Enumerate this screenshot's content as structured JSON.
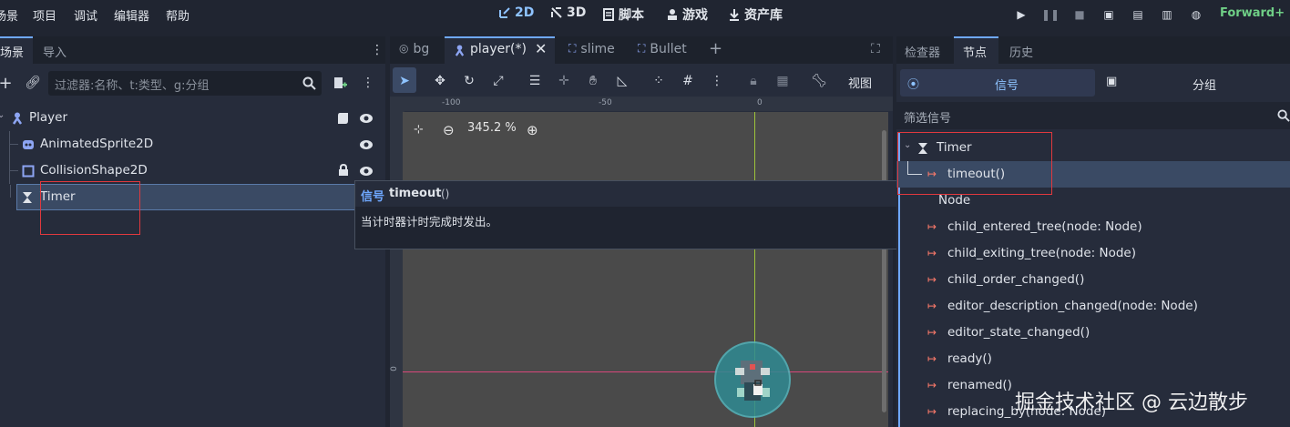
{
  "menu": [
    "场景",
    "项目",
    "调试",
    "编辑器",
    "帮助"
  ],
  "workspaces": [
    {
      "label": "2D",
      "active": true
    },
    {
      "label": "3D",
      "active": false
    },
    {
      "label": "脚本",
      "active": false
    },
    {
      "label": "游戏",
      "active": false
    },
    {
      "label": "资产库",
      "active": false
    }
  ],
  "renderer": "Forward+",
  "left_dock": {
    "tabs": [
      "场景",
      "导入"
    ],
    "filter_placeholder": "过滤器:名称、t:类型、g:分组",
    "tree": [
      {
        "label": "Player",
        "icon": "character-body-icon"
      },
      {
        "label": "AnimatedSprite2D",
        "icon": "animated-sprite-icon"
      },
      {
        "label": "CollisionShape2D",
        "icon": "collision-shape-icon"
      },
      {
        "label": "Timer",
        "icon": "timer-icon",
        "selected": true
      }
    ]
  },
  "center": {
    "tabs": [
      {
        "label": "bg",
        "active": false
      },
      {
        "label": "player(*)",
        "active": true
      },
      {
        "label": "slime",
        "active": false
      },
      {
        "label": "Bullet",
        "active": false
      }
    ],
    "view_label": "视图",
    "zoom": "345.2 %",
    "ruler_top": [
      "-100",
      "-50",
      "0"
    ],
    "ruler_left": [
      "0"
    ]
  },
  "tooltip": {
    "kind": "信号",
    "name": "timeout",
    "parens": "()",
    "description": "当计时器计时完成时发出。"
  },
  "right_dock": {
    "tabs": [
      "检查器",
      "节点",
      "历史"
    ],
    "subtabs": [
      "信号",
      "分组"
    ],
    "filter_placeholder": "筛选信号",
    "class_timer": "Timer",
    "class_node": "Node",
    "signals_timer": [
      "timeout()"
    ],
    "signals_node": [
      "child_entered_tree(node: Node)",
      "child_exiting_tree(node: Node)",
      "child_order_changed()",
      "editor_description_changed(node: Node)",
      "editor_state_changed()",
      "ready()",
      "renamed()",
      "replacing_by(node: Node)"
    ]
  },
  "watermark": "掘金技术社区 @ 云边散步",
  "colors": {
    "accent": "#6fa8ff",
    "highlight_box": "#e0393e",
    "signal_icon": "#ff7b6b"
  }
}
